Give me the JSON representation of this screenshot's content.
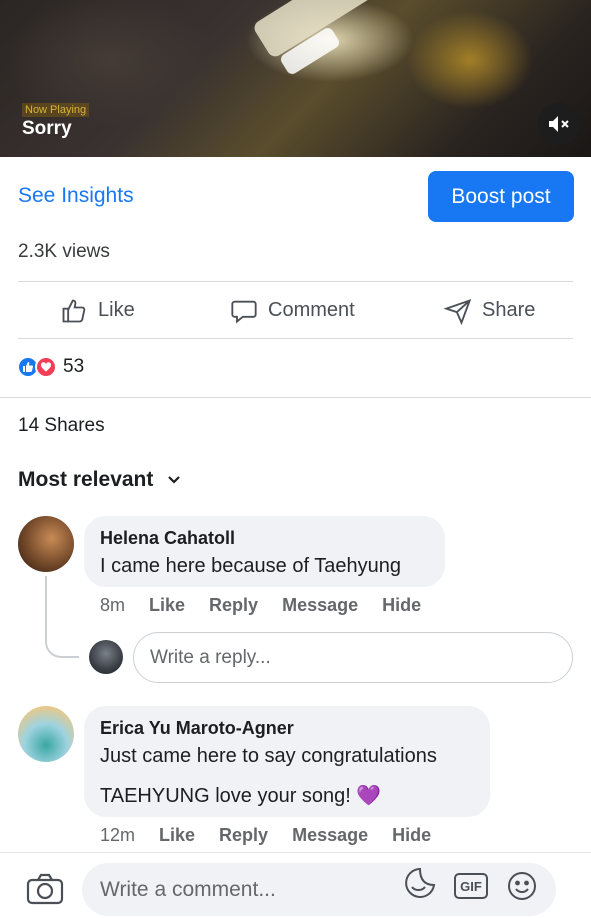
{
  "video": {
    "now_playing": "Now Playing",
    "song_title": "Sorry",
    "mute_icon": "speaker-muted-icon"
  },
  "insights": {
    "label": "See Insights"
  },
  "boost": {
    "label": "Boost post"
  },
  "views": "2.3K views",
  "actions": {
    "like": "Like",
    "comment": "Comment",
    "share": "Share"
  },
  "reactions": {
    "count": "53",
    "types": [
      "like",
      "love"
    ]
  },
  "shares": "14 Shares",
  "sort": {
    "label": "Most relevant"
  },
  "comments": [
    {
      "name": "Helena Cahatoll",
      "text_lines": [
        "I came here because of Taehyung"
      ],
      "time": "8m",
      "like": "Like",
      "reply": "Reply",
      "message": "Message",
      "hide": "Hide"
    },
    {
      "name": "Erica Yu Maroto-Agner",
      "text_lines": [
        "Just came here to say congratulations",
        "TAEHYUNG love your song! 💜"
      ],
      "time": "12m",
      "like": "Like",
      "reply": "Reply",
      "message": "Message",
      "hide": "Hide"
    }
  ],
  "reply_box": {
    "placeholder": "Write a reply..."
  },
  "composer": {
    "placeholder": "Write a comment...",
    "gif_label": "GIF"
  },
  "colors": {
    "accent": "#1877f2",
    "love": "#f33e58",
    "bubble": "#f0f2f5"
  }
}
